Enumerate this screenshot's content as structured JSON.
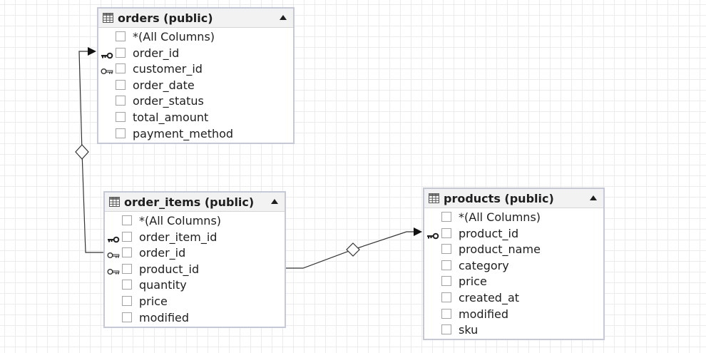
{
  "colors": {
    "table_border": "#c5c8d8",
    "header_bg": "#f2f2f2",
    "link_line": "#333333",
    "text": "#1e1e1e"
  },
  "tables": {
    "orders": {
      "title": "orders (public)",
      "columns": [
        {
          "label": "*(All Columns)",
          "key": "none"
        },
        {
          "label": "order_id",
          "key": "primary-key-icon"
        },
        {
          "label": "customer_id",
          "key": "foreign-key-icon"
        },
        {
          "label": "order_date",
          "key": "none"
        },
        {
          "label": "order_status",
          "key": "none"
        },
        {
          "label": "total_amount",
          "key": "none"
        },
        {
          "label": "payment_method",
          "key": "none"
        }
      ]
    },
    "order_items": {
      "title": "order_items (public)",
      "columns": [
        {
          "label": "*(All Columns)",
          "key": "none"
        },
        {
          "label": "order_item_id",
          "key": "primary-key-icon"
        },
        {
          "label": "order_id",
          "key": "foreign-key-icon"
        },
        {
          "label": "product_id",
          "key": "foreign-key-icon"
        },
        {
          "label": "quantity",
          "key": "none"
        },
        {
          "label": "price",
          "key": "none"
        },
        {
          "label": "modified",
          "key": "none"
        }
      ]
    },
    "products": {
      "title": "products (public)",
      "columns": [
        {
          "label": "*(All Columns)",
          "key": "none"
        },
        {
          "label": "product_id",
          "key": "primary-key-icon"
        },
        {
          "label": "product_name",
          "key": "none"
        },
        {
          "label": "category",
          "key": "none"
        },
        {
          "label": "price",
          "key": "none"
        },
        {
          "label": "created_at",
          "key": "none"
        },
        {
          "label": "modified",
          "key": "none"
        },
        {
          "label": "sku",
          "key": "none"
        }
      ]
    }
  }
}
